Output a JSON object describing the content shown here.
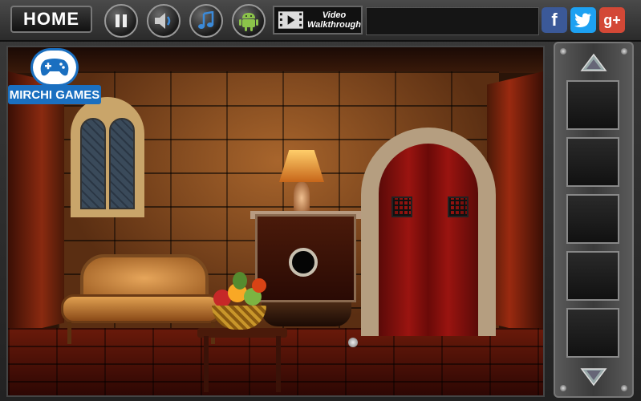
{
  "topbar": {
    "home_label": "HOME",
    "video_label_line1": "Video",
    "video_label_line2": "Walkthrough",
    "buttons": [
      "pause-icon",
      "speaker-icon",
      "music-note-icon",
      "android-icon",
      "video-film-icon"
    ],
    "social": [
      {
        "name": "facebook-icon",
        "glyph": "f",
        "color": "#3b5998"
      },
      {
        "name": "twitter-icon",
        "glyph": "t",
        "color": "#1da1f2"
      },
      {
        "name": "google-plus-icon",
        "glyph": "g+",
        "color": "#d34836"
      }
    ]
  },
  "logo": {
    "text": "MIRCHI GAMES",
    "color": "#1a6fc0"
  },
  "inventory": {
    "slot_count": 5,
    "up_arrow": "arrow-up-icon",
    "down_arrow": "arrow-down-icon"
  }
}
